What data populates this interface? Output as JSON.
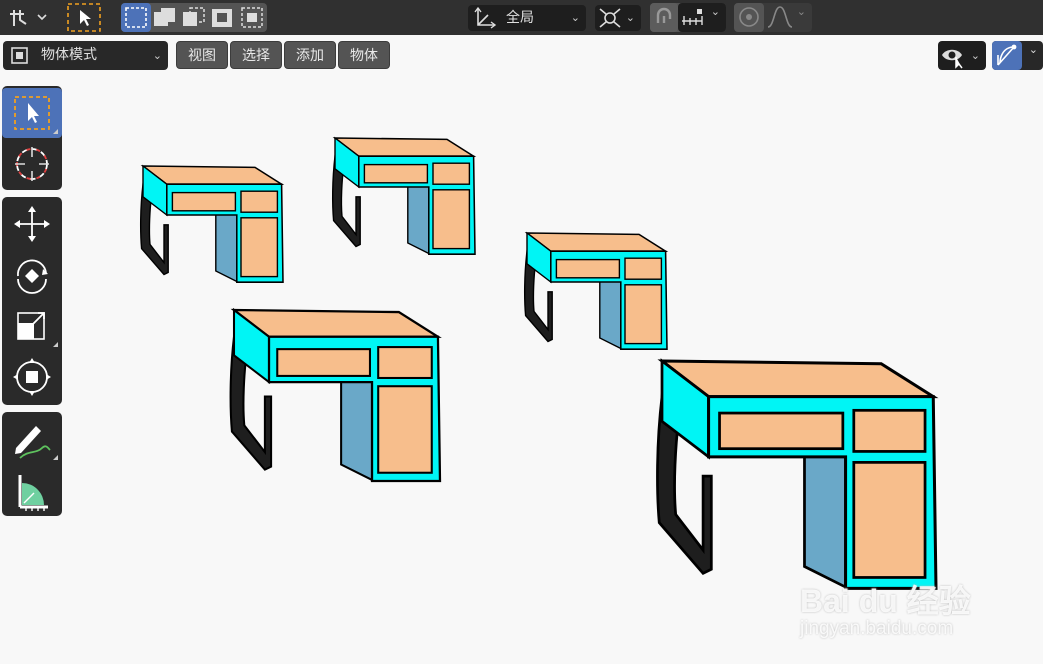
{
  "top_header": {
    "transform_orientation": "全局",
    "icons": [
      "editor-type-icon",
      "select-tool-icon",
      "select-box-icon",
      "select-extend-icon",
      "select-subtract-icon",
      "select-invert-icon",
      "select-intersect-icon",
      "orientation-axes-icon",
      "pivot-point-icon",
      "snap-icon",
      "snap-increment-icon",
      "proportional-edit-icon",
      "falloff-curve-icon"
    ]
  },
  "header": {
    "mode": "物体模式",
    "menus": [
      "视图",
      "选择",
      "添加",
      "物体"
    ],
    "right_icons": [
      "visibility-eye-icon",
      "gizmo-icon"
    ]
  },
  "toolbar": {
    "tools": [
      "select-box",
      "cursor",
      "move",
      "rotate",
      "scale",
      "transform",
      "annotate",
      "measure"
    ],
    "active": "select-box"
  },
  "watermark": {
    "logo_text": "Bai du 经验",
    "url": "jingyan.baidu.com"
  },
  "colors": {
    "desk_frame": "#00f5f5",
    "desk_top": "#f7be8c",
    "desk_side": "#6aa8c8",
    "leg": "#1e1e1e",
    "active_tool": "#4d72b8",
    "header_bg": "#303030",
    "viewport_bg": "#f8f8f8"
  }
}
